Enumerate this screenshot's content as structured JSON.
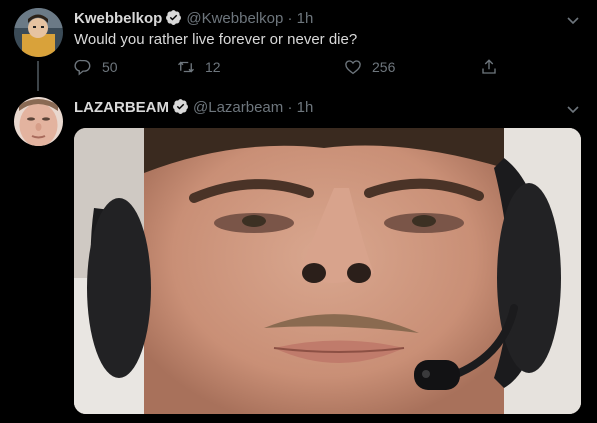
{
  "tweets": [
    {
      "display_name": "Kwebbelkop",
      "handle": "@Kwebbelkop",
      "separator": "·",
      "time": "1h",
      "text": "Would you rather live forever or never die?",
      "reply_count": "50",
      "retweet_count": "12",
      "like_count": "256",
      "icons": [
        "verified-badge-icon",
        "chevron-down-icon",
        "reply-icon",
        "retweet-icon",
        "like-icon",
        "share-icon"
      ]
    },
    {
      "display_name": "LAZARBEAM",
      "handle": "@Lazarbeam",
      "separator": "·",
      "time": "1h",
      "icons": [
        "verified-badge-icon",
        "chevron-down-icon"
      ]
    }
  ],
  "colors": {
    "background": "#000000",
    "primary_text": "#d9d9d9",
    "secondary_text": "#6e767d",
    "thread_line": "#3d4449"
  }
}
